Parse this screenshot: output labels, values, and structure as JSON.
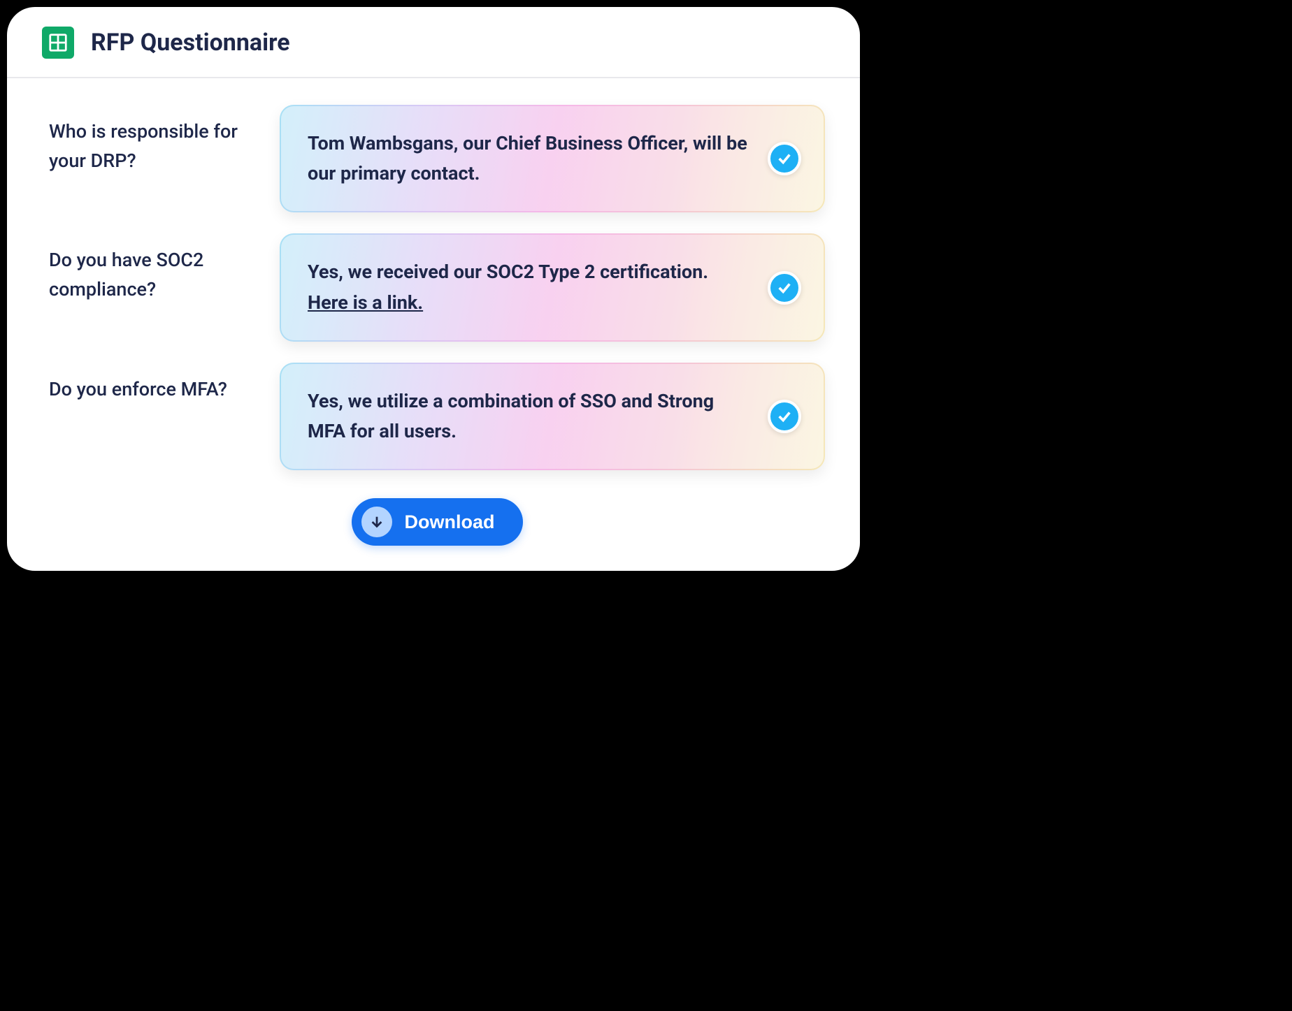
{
  "header": {
    "title": "RFP Questionnaire"
  },
  "qa": [
    {
      "question": "Who is responsible for your DRP?",
      "answer": "Tom Wambsgans, our Chief Business Officer, will be our primary contact.",
      "link": null
    },
    {
      "question": "Do you have SOC2 compliance?",
      "answer": "Yes, we received our SOC2 Type 2 certification. ",
      "link": "Here is a link."
    },
    {
      "question": "Do you enforce MFA?",
      "answer": "Yes, we utilize a combination of SSO and Strong MFA for all users.",
      "link": null
    }
  ],
  "download": {
    "label": "Download"
  }
}
